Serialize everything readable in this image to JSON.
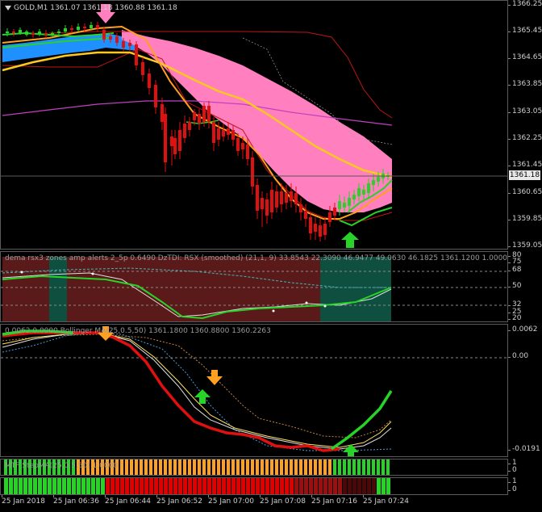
{
  "main": {
    "title": "GOLD,M1  1361.07 1361.18 1360.88 1361.18",
    "price_box": "1361.18",
    "axis": [
      "1366.25",
      "1365.45",
      "1364.65",
      "1363.85",
      "1363.05",
      "1362.25",
      "1361.45",
      "1360.65",
      "1359.85",
      "1359.05"
    ]
  },
  "rsx": {
    "title": "dema rsx3 zones amp alerts 2_5p 0.6490  DzTDI:  RSX (smoothed) (21,1, 9) 33.8543 22.3090 46.9477 49.0630 46.1825 1361.1200 1.0000",
    "axis": [
      "80",
      "75",
      "68",
      "50",
      "32",
      "25",
      "20"
    ]
  },
  "ma": {
    "title": "0.0062  0.0000  Bollinger MA(25,0.5,50) 1361.1800 1360.8800 1360.2263",
    "axis": [
      "0.0062",
      "0.00",
      "-0.0191"
    ]
  },
  "strip1": {
    "title": "MTF StepMA(25,0.5,50) 1.0000",
    "axis": [
      "1",
      "0"
    ]
  },
  "strip2": {
    "title": "",
    "axis": [
      "1",
      "0"
    ]
  },
  "time_axis": [
    "25 Jan 2018",
    "25 Jan 06:36",
    "25 Jan 06:44",
    "25 Jan 06:52",
    "25 Jan 07:00",
    "25 Jan 07:08",
    "25 Jan 07:16",
    "25 Jan 07:24"
  ],
  "colors": {
    "bull": "#27d327",
    "bear": "#e01010",
    "pink": "#ff7fbf",
    "blue": "#1e90ff",
    "yellow": "#ffc81e",
    "orange": "#ffa020",
    "magenta": "#c040c0",
    "teal": "#0f4f3f",
    "maroon": "#5a1a1a"
  }
}
